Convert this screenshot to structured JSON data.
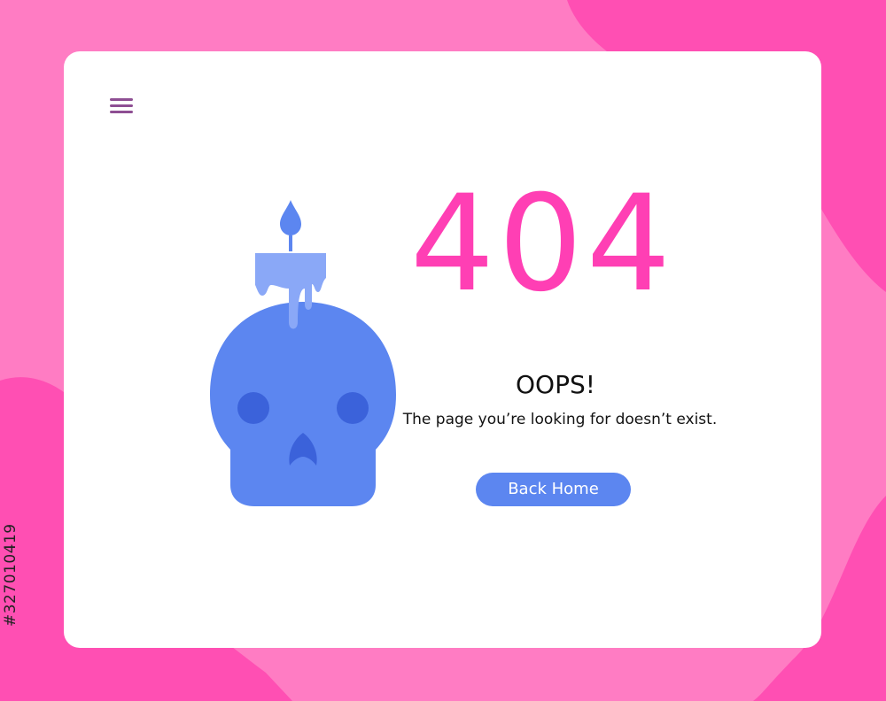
{
  "colors": {
    "background": "#ff7cc3",
    "background_dark": "#ff4fb3",
    "card": "#ffffff",
    "accent_pink": "#ff3fb4",
    "skull_blue": "#5c86f0",
    "button_blue": "#5c86f0",
    "menu_icon": "#8e4f93"
  },
  "header": {
    "menu_icon": "hamburger-menu-icon"
  },
  "error": {
    "code": "404",
    "title": "OOPS!",
    "message": "The page you’re looking for doesn’t exist."
  },
  "actions": {
    "back_home_label": "Back Home"
  },
  "illustration": {
    "icon": "skull-candle-icon"
  },
  "watermark": {
    "stock_id": "#327010419"
  }
}
